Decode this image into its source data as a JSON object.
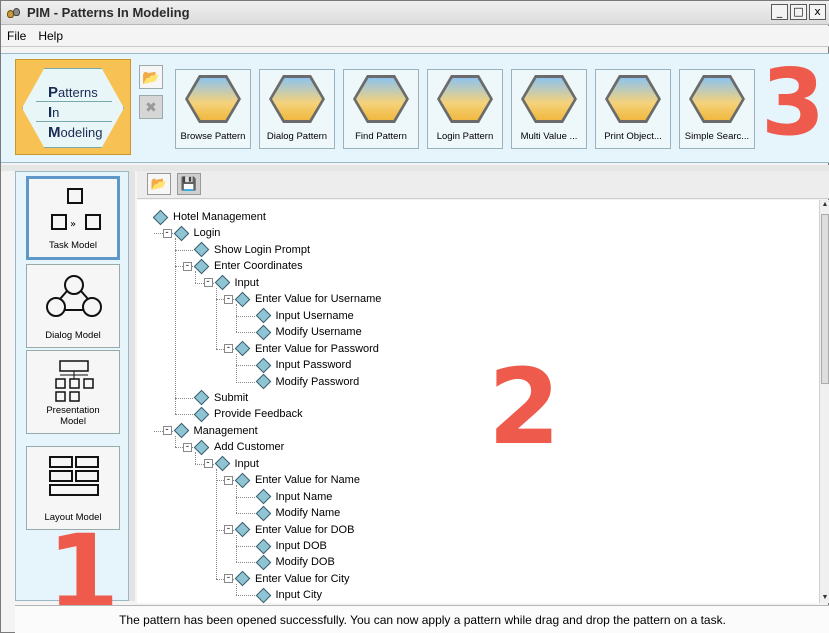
{
  "window": {
    "title": "PIM - Patterns In Modeling",
    "controls": [
      "_",
      "□",
      "x"
    ]
  },
  "menu": [
    "File",
    "Help"
  ],
  "logo": {
    "line1": "atterns",
    "line1_initial": "P",
    "line2": "n",
    "line2_initial": "I",
    "line3": "odeling",
    "line3_initial": "M"
  },
  "toolbar_icons": [
    "open-pattern-icon",
    "disabled-close-icon"
  ],
  "patterns": [
    "Browse Pattern",
    "Dialog Pattern",
    "Find Pattern",
    "Login Pattern",
    "Multi Value ...",
    "Print Object...",
    "Simple Searc..."
  ],
  "models": [
    {
      "label": "Task Model",
      "selected": true
    },
    {
      "label": "Dialog Model",
      "selected": false
    },
    {
      "label": "Presentation Model",
      "selected": false
    },
    {
      "label": "Layout Model",
      "selected": false
    }
  ],
  "annotations": {
    "one": "1",
    "two": "2",
    "three": "3"
  },
  "tree": [
    {
      "label": "Hotel Management",
      "level": 0,
      "expander": ""
    },
    {
      "label": "Login",
      "level": 1,
      "expander": "-"
    },
    {
      "label": "Show Login Prompt",
      "level": 2,
      "expander": ""
    },
    {
      "label": "Enter Coordinates",
      "level": 2,
      "expander": "-"
    },
    {
      "label": "Input",
      "level": 3,
      "expander": "-"
    },
    {
      "label": "Enter Value for Username",
      "level": 4,
      "expander": "-"
    },
    {
      "label": "Input Username",
      "level": 5,
      "expander": ""
    },
    {
      "label": "Modify Username",
      "level": 5,
      "expander": ""
    },
    {
      "label": "Enter Value for Password",
      "level": 4,
      "expander": "-"
    },
    {
      "label": "Input Password",
      "level": 5,
      "expander": ""
    },
    {
      "label": "Modify Password",
      "level": 5,
      "expander": ""
    },
    {
      "label": "Submit",
      "level": 2,
      "expander": ""
    },
    {
      "label": "Provide Feedback",
      "level": 2,
      "expander": ""
    },
    {
      "label": "Management",
      "level": 1,
      "expander": "-"
    },
    {
      "label": "Add Customer",
      "level": 2,
      "expander": "-"
    },
    {
      "label": "Input",
      "level": 3,
      "expander": "-"
    },
    {
      "label": "Enter Value for Name",
      "level": 4,
      "expander": "-"
    },
    {
      "label": "Input Name",
      "level": 5,
      "expander": ""
    },
    {
      "label": "Modify Name",
      "level": 5,
      "expander": ""
    },
    {
      "label": "Enter Value for DOB",
      "level": 4,
      "expander": "-"
    },
    {
      "label": "Input DOB",
      "level": 5,
      "expander": ""
    },
    {
      "label": "Modify DOB",
      "level": 5,
      "expander": ""
    },
    {
      "label": "Enter Value for City",
      "level": 4,
      "expander": "-"
    },
    {
      "label": "Input City",
      "level": 5,
      "expander": ""
    }
  ],
  "status": "The pattern has been opened successfully. You can now apply a pattern while drag and drop the pattern on a task."
}
